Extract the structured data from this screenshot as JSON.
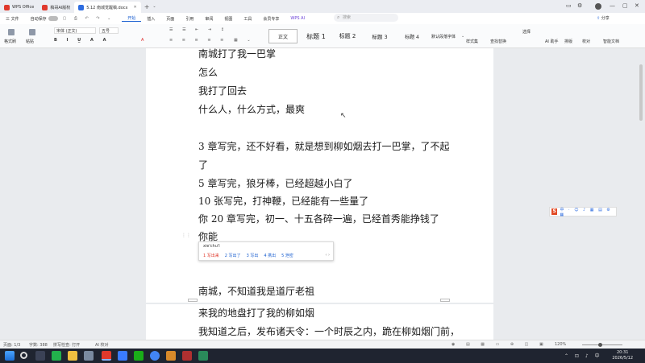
{
  "titlebar": {
    "tabs": [
      {
        "label": "WPS Office",
        "color": "#e0392c"
      },
      {
        "label": "稿哥AI版权",
        "color": "#e0392c"
      },
      {
        "label": "5.12 南城觉醒稿.docx",
        "color": "#2d6ce0",
        "active": true
      }
    ]
  },
  "menubar": {
    "file": "三 文件",
    "autosave": "自动保存",
    "items": [
      "开始",
      "插入",
      "页面",
      "引用",
      "审阅",
      "视图",
      "工具",
      "会员专享",
      "WPS AI"
    ],
    "active": "开始",
    "search_placeholder": "搜索",
    "share": "分享"
  },
  "ribbon": {
    "paste": "格式刷",
    "copy": "粘贴",
    "font_name": "宋体 (正文)",
    "font_size": "五号",
    "styles": [
      "正文",
      "标题 1",
      "标题 2",
      "标题 3",
      "标题 4",
      "默认段落字体"
    ],
    "right_tools": [
      "样式集",
      "查找替换",
      "选择",
      "AI 助手",
      "排版",
      "校对",
      "智能文档"
    ]
  },
  "document": {
    "page1_lines": [
      "南城打了我一巴掌",
      "怎么",
      "我打了回去",
      "什么人，什么方式，最爽",
      "",
      "3 章写完，还不好看，就是想到柳如烟去打一巴掌，了不起",
      "了",
      "5 章写完，狼牙棒，已经超越小白了",
      "10 张写完，打神鞭，已经能有一些量了",
      "你 20 章写完，初一、十五各碎一遍，已经首秀能挣钱了",
      "你能"
    ],
    "page1_tail": "南城，不知道我是道厅老祖",
    "page2_lines": [
      "来我的地盘打了我的柳如烟",
      "我知道之后，发布诸天令：一个时辰之内，跪在柳如烟门前，"
    ]
  },
  "ime": {
    "pinyin": "xie'chu'l",
    "candidates": [
      "1 写出来",
      "2 写出了",
      "3 写出",
      "4 携出",
      "5 泄密"
    ]
  },
  "statusbar": {
    "page": "页面: 1/3",
    "words": "字数: 388",
    "spell": "拼写检查: 打开",
    "ai": "AI 校对",
    "zoom": "120%"
  },
  "taskbar": {
    "time": "20:31",
    "date": "2026/5/12"
  }
}
